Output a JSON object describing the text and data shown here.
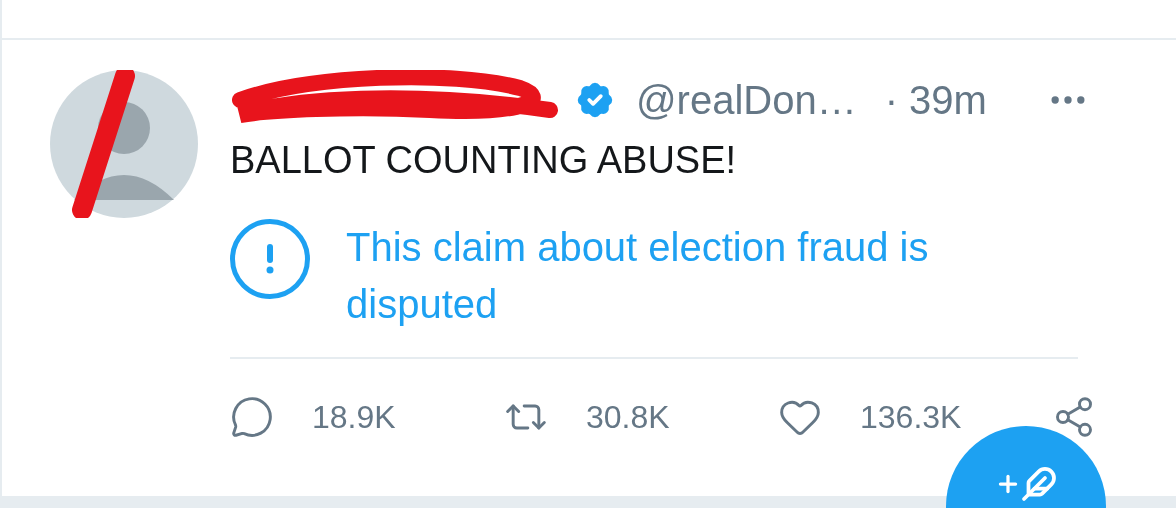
{
  "tweet": {
    "verified": true,
    "handle": "@realDon…",
    "time": "· 39m",
    "text": "BALLOT COUNTING ABUSE!",
    "notice": "This claim about election fraud is disputed",
    "actions": [
      {
        "kind": "reply",
        "count": "18.9K"
      },
      {
        "kind": "retweet",
        "count": "30.8K"
      },
      {
        "kind": "like",
        "count": "136.3K"
      },
      {
        "kind": "share"
      }
    ]
  }
}
